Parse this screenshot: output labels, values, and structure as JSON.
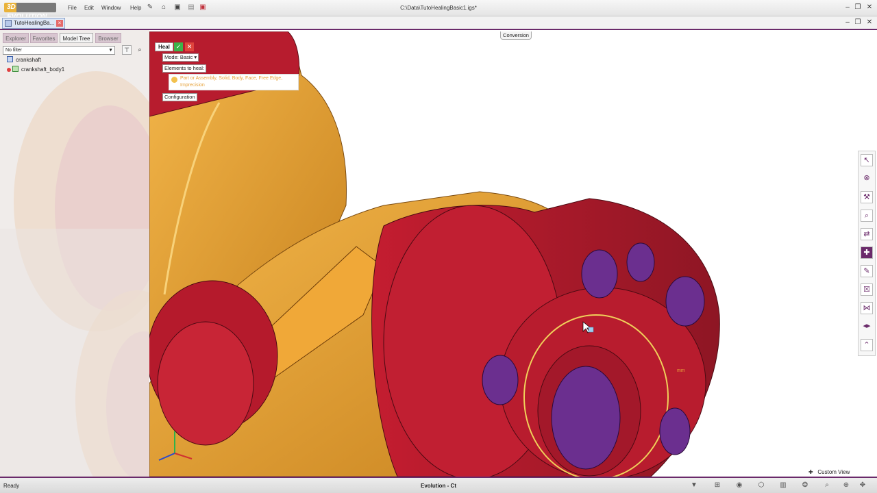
{
  "app": {
    "logo": "3D EVOLUTION",
    "window_title": "C:\\Data\\TutoHealingBasic1.igs*"
  },
  "menu": [
    "File",
    "Edit",
    "Window",
    "Help"
  ],
  "toolbar_icons": [
    "pen-icon",
    "open-folder-icon",
    "save-icon",
    "save-red-icon"
  ],
  "document_tab": {
    "label": "TutoHealingBa..."
  },
  "sidebar": {
    "tabs": [
      "Explorer",
      "Favorites",
      "Model Tree",
      "Browser"
    ],
    "active_tab": "Model Tree",
    "filter": "No filter",
    "tree": [
      "crankshaft",
      "crankshaft_body1"
    ]
  },
  "heal_panel": {
    "title": "Heal",
    "mode": "Mode: Basic",
    "elements_label": "Elements to heal:",
    "hint": "Part or Assembly, Solid, Body, Face, Free Edge, Imprecision",
    "configuration": "Configuration"
  },
  "viewport": {
    "conversion_tab": "Conversion",
    "unit_label": "mm",
    "custom_view": "Custom View"
  },
  "status": {
    "left": "Ready",
    "center": "Evolution - Ct"
  },
  "colors": {
    "accent": "#6a2a6a",
    "part_red": "#b5192a",
    "part_gold": "#e9a53a",
    "hole_purple": "#6b2f8f"
  }
}
